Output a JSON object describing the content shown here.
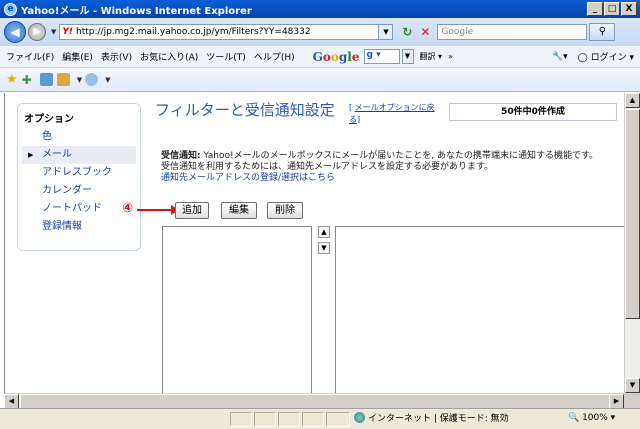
{
  "window": {
    "title": "Yahoo!メール - Windows Internet Explorer",
    "minimize": "_",
    "maximize": "□",
    "close": "X"
  },
  "address": {
    "url": "http://jp.mg2.mail.yahoo.co.jp/ym/Filters?YY=48332",
    "search_placeholder": "Google"
  },
  "menu": {
    "items": [
      "ファイル(F)",
      "編集(E)",
      "表示(V)",
      "お気に入り(A)",
      "ツール(T)",
      "ヘルプ(H)"
    ],
    "google_box": "g ▾",
    "translate": "翻訳 ▾",
    "more": "»",
    "login": "ログイン ▾"
  },
  "sidebar": {
    "header": "オプション",
    "items": [
      {
        "label": "色"
      },
      {
        "label": "メール",
        "selected": true
      },
      {
        "label": "アドレスブック"
      },
      {
        "label": "カレンダー"
      },
      {
        "label": "ノートパッド"
      },
      {
        "label": "登録情報"
      }
    ]
  },
  "main": {
    "title": "フィルターと受信通知設定",
    "back_link_bracket_open": "[",
    "back_link_line1": "メールオプションに戻",
    "back_link_line2": "る",
    "back_link_bracket_close": "]",
    "count": "50件中0件作成",
    "desc_label": "受信通知:",
    "desc_text": " Yahoo!メールのメールボックスにメールが届いたことを, あなたの携帯端末に通知する機能です。",
    "desc_line2": "受信通知を利用するためには、通知先メールアドレスを設定する必要があります。",
    "desc_link": "通知先メールアドレスの登録/選択はこちら",
    "marker": "④",
    "add_button": "追加",
    "edit_button": "編集",
    "delete_button": "削除",
    "up": "▲",
    "down": "▼"
  },
  "status": {
    "zone": "インターネット | 保護モード: 無効",
    "zoom": "100%"
  },
  "colors": {
    "title_bar": "#0a5fd8",
    "link": "#1a3ea8",
    "page_title": "#2d5ab8",
    "annotation": "#d01818"
  }
}
